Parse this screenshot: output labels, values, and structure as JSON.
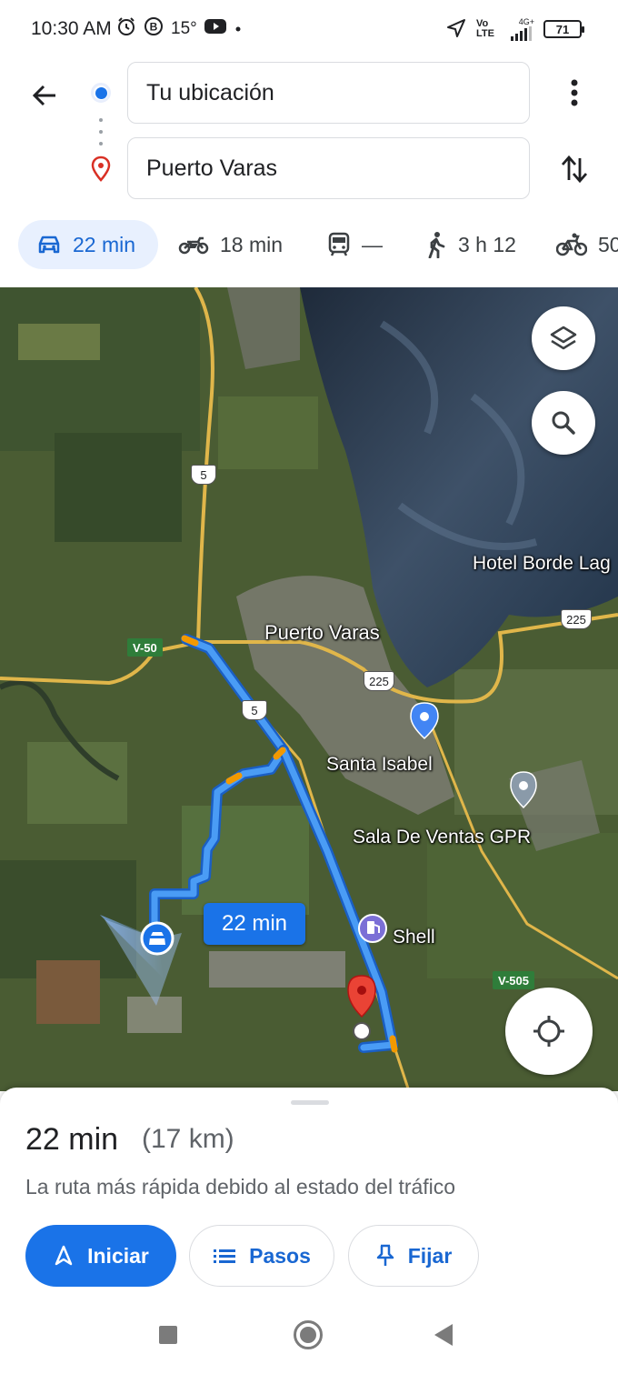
{
  "status_bar": {
    "time": "10:30 AM",
    "temperature": "15°",
    "network": "4G+",
    "volte": "Vo LTE",
    "battery": "71"
  },
  "search": {
    "origin": "Tu ubicación",
    "destination": "Puerto Varas"
  },
  "modes": [
    {
      "icon": "car-icon",
      "label": "22 min",
      "selected": true
    },
    {
      "icon": "motorcycle-icon",
      "label": "18 min"
    },
    {
      "icon": "train-icon",
      "label": "—"
    },
    {
      "icon": "walk-icon",
      "label": "3 h 12"
    },
    {
      "icon": "bike-icon",
      "label": "50"
    }
  ],
  "map": {
    "labels": {
      "puerto_varas": "Puerto Varas",
      "hotel": "Hotel Borde Lag",
      "santa_isabel": "Santa Isabel",
      "sala_ventas": "Sala De Ventas GPR",
      "shell": "Shell"
    },
    "road_shields": {
      "r5_north": "5",
      "r5_south": "5",
      "r225_east": "225",
      "r225_center": "225"
    },
    "route_tags": {
      "v50": "V-50",
      "v505": "V-505"
    },
    "route_time": "22 min",
    "route_color": "#4a9cf5",
    "traffic_color": "#f29900"
  },
  "summary": {
    "duration": "22 min",
    "distance": "(17 km)",
    "description": "La ruta más rápida debido al estado del tráfico"
  },
  "actions": {
    "start": "Iniciar",
    "steps": "Pasos",
    "pin": "Fijar"
  }
}
